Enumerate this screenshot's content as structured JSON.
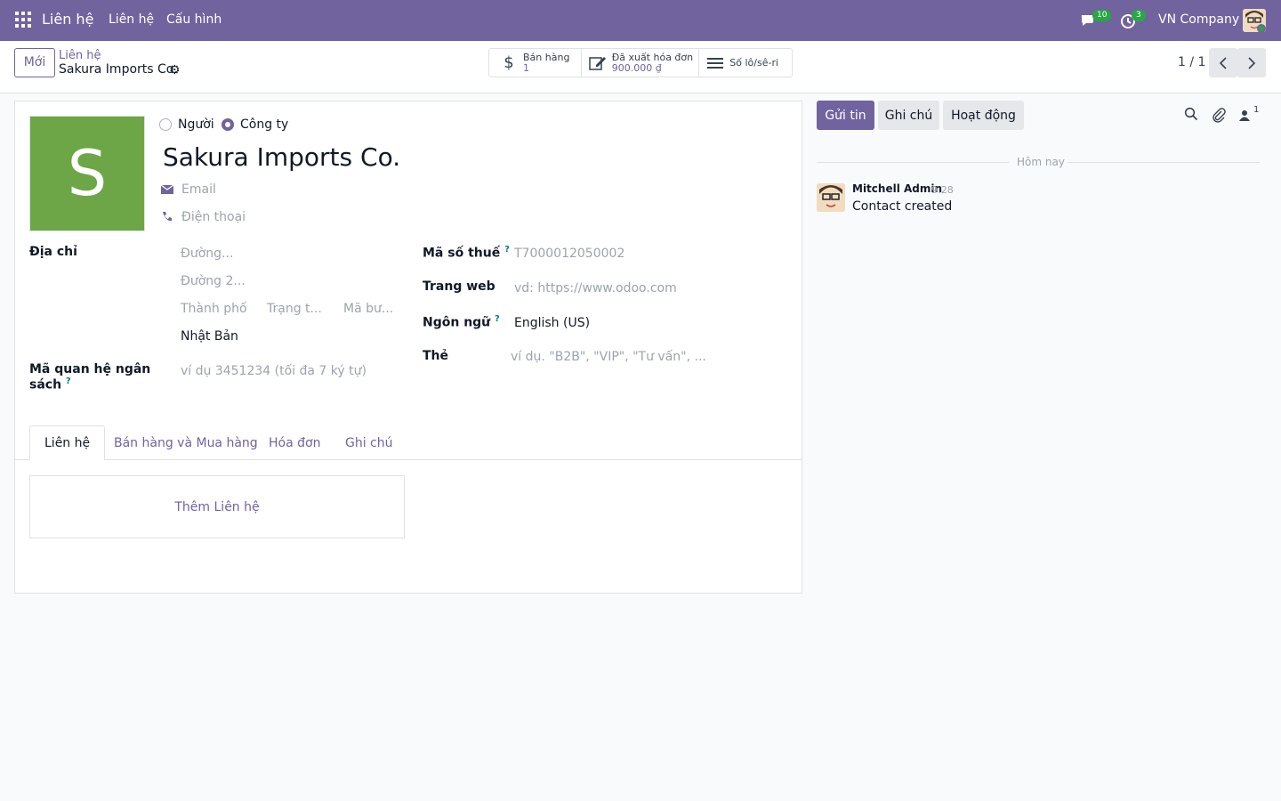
{
  "navbar": {
    "app_title": "Liên hệ",
    "menu": [
      "Liên hệ",
      "Cấu hình"
    ],
    "messages_badge": "10",
    "activities_badge": "3",
    "company": "VN Company"
  },
  "control_panel": {
    "new_button": "Mới",
    "breadcrumb_parent": "Liên hệ",
    "breadcrumb_current": "Sakura Imports Co.",
    "smart_buttons": [
      {
        "label": "Bán hàng",
        "value": "1",
        "icon": "dollar-icon"
      },
      {
        "label": "Đã xuất hóa đơn",
        "value": "900.000 ₫",
        "icon": "edit-icon"
      },
      {
        "label": "Số lô/sê-ri",
        "value": "",
        "icon": "list-icon"
      }
    ],
    "pager": "1 / 1"
  },
  "form": {
    "avatar_letter": "S",
    "avatar_color": "#6da646",
    "radio_person": "Người",
    "radio_company": "Công ty",
    "company_type_selected": "Công ty",
    "name": "Sakura Imports Co.",
    "email_placeholder": "Email",
    "phone_placeholder": "Điện thoại",
    "address_label": "Địa chỉ",
    "street_placeholder": "Đường...",
    "street2_placeholder": "Đường 2...",
    "city_placeholder": "Thành phố",
    "state_placeholder": "Trạng t...",
    "zip_placeholder": "Mã bư...",
    "country": "Nhật Bản",
    "bank_code_label_1": "Mã quan hệ ngân",
    "bank_code_label_2": "sách",
    "bank_code_placeholder": "ví dụ 3451234 (tối đa 7 ký tự)",
    "vat_label": "Mã số thuế",
    "vat_placeholder": "T7000012050002",
    "website_label": "Trang web",
    "website_placeholder": "vd: https://www.odoo.com",
    "language_label": "Ngôn ngữ",
    "language": "English (US)",
    "tags_label": "Thẻ",
    "tags_placeholder": "ví dụ. \"B2B\", \"VIP\", \"Tư vấn\", ...",
    "help_mark": "?"
  },
  "tabs": [
    "Liên hệ",
    "Bán hàng và Mua hàng",
    "Hóa đơn",
    "Ghi chú"
  ],
  "active_tab": "Liên hệ",
  "add_contact": "Thêm Liên hệ",
  "chatter": {
    "send_message": "Gửi tin",
    "log_note": "Ghi chú",
    "activities": "Hoạt động",
    "followers_count": "1",
    "date_separator": "Hôm nay",
    "message": {
      "author": "Mitchell Admin",
      "time": "9:28",
      "body": "Contact created"
    }
  },
  "colors": {
    "brand": "#71639e",
    "accent_green": "#28a745"
  }
}
